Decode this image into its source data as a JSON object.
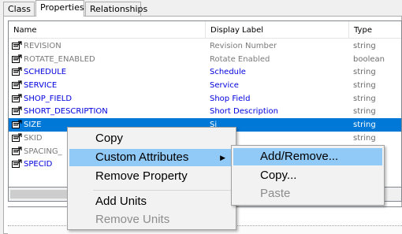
{
  "tabs": [
    {
      "label": "Class"
    },
    {
      "label": "Properties"
    },
    {
      "label": "Relationships"
    }
  ],
  "active_tab": "Properties",
  "columns": {
    "name": "Name",
    "display_label": "Display Label",
    "type": "Type"
  },
  "rows": [
    {
      "name": "REVISION",
      "label": "Revision Number",
      "type": "string",
      "style": "gray"
    },
    {
      "name": "ROTATE_ENABLED",
      "label": "Rotate Enabled",
      "type": "boolean",
      "style": "gray"
    },
    {
      "name": "SCHEDULE",
      "label": "Schedule",
      "type": "string",
      "style": "blue"
    },
    {
      "name": "SERVICE",
      "label": "Service",
      "type": "string",
      "style": "blue"
    },
    {
      "name": "SHOP_FIELD",
      "label": "Shop Field",
      "type": "string",
      "style": "blue"
    },
    {
      "name": "SHORT_DESCRIPTION",
      "label": "Short Description",
      "type": "string",
      "style": "blue"
    },
    {
      "name": "SIZE",
      "label": "Si",
      "type": "string",
      "style": "selected"
    },
    {
      "name": "SKID",
      "label": "",
      "type": "string",
      "style": "gray"
    },
    {
      "name": "SPACING_",
      "label": "",
      "type": "string",
      "style": "gray"
    },
    {
      "name": "SPECID",
      "label": "",
      "type": "string",
      "style": "blue"
    }
  ],
  "context_menu": {
    "copy": "Copy",
    "custom_attributes": "Custom Attributes",
    "remove_property": "Remove Property",
    "add_units": "Add Units",
    "remove_units": "Remove Units"
  },
  "submenu": {
    "add_remove": "Add/Remove...",
    "copy": "Copy...",
    "paste": "Paste"
  },
  "colors": {
    "selection": "#0078d7",
    "menu_hover": "#91c9f7",
    "link_text": "#0000e0",
    "muted_text": "#7a7a7a"
  },
  "icons": {
    "row_icon": "property-icon",
    "submenu_arrow": "chevron-right-icon"
  }
}
